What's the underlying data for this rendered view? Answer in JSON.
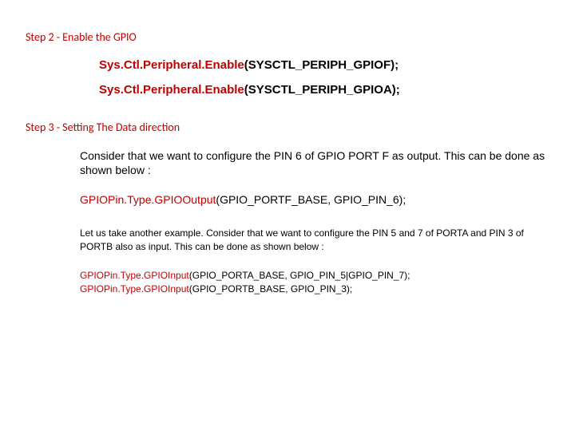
{
  "step2": {
    "heading": "Step 2 - Enable the GPIO",
    "code1": {
      "redPart": "Sys.Ctl.Peripheral.Enable",
      "blackPart": "(SYSCTL_PERIPH_GPIOF);"
    },
    "code2": {
      "redPart": "Sys.Ctl.Peripheral.Enable",
      "blackPart": "(SYSCTL_PERIPH_GPIOA);"
    }
  },
  "step3": {
    "heading": "Step 3 - Setting The Data direction",
    "para1": "Consider that we want to configure the PIN 6 of GPIO PORT F as output. This can be done as shown below :",
    "code1": {
      "redPart": "GPIOPin.Type.GPIOOutput",
      "blackPart": "(GPIO_PORTF_BASE, GPIO_PIN_6);"
    },
    "para2": "Let us take another example. Consider that we want to configure the PIN 5 and 7 of PORTA and PIN 3 of PORTB also as input. This can be done as shown below :",
    "code2a": {
      "redPart": "GPIOPin.Type.GPIOInput",
      "blackPart": "(GPIO_PORTA_BASE, GPIO_PIN_5|GPIO_PIN_7);"
    },
    "code2b": {
      "redPart": "GPIOPin.Type.GPIOInput",
      "blackPart": "(GPIO_PORTB_BASE, GPIO_PIN_3);"
    }
  }
}
